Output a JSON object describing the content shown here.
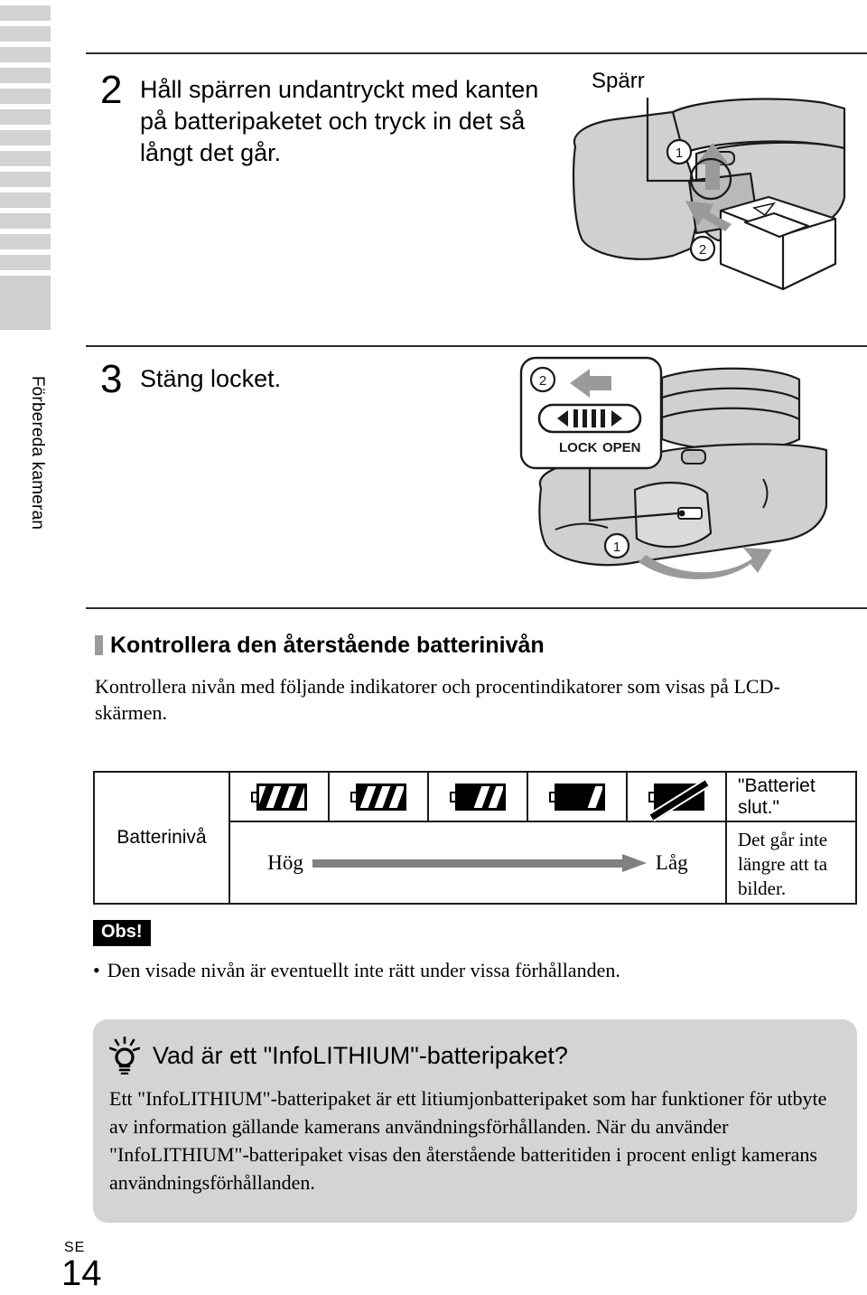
{
  "chapter_tab": {
    "label": "Förbereda kameran"
  },
  "steps": [
    {
      "number": "2",
      "text": "Håll spärren undantryckt med kanten på batteripaketet och tryck in det så långt det går.",
      "callout_label": "Spärr",
      "markers": [
        "1",
        "2"
      ]
    },
    {
      "number": "3",
      "text": "Stäng locket.",
      "switch_left_label": "LOCK",
      "switch_right_label": "OPEN",
      "markers": [
        "2",
        "1"
      ]
    }
  ],
  "section": {
    "heading": "Kontrollera den återstående batterinivån",
    "intro": "Kontrollera nivån med följande indikatorer och procentindikatorer som visas på LCD-skärmen."
  },
  "battery_table": {
    "row_label": "Batterinivå",
    "icons": [
      {
        "name": "battery-full-icon",
        "level": "full"
      },
      {
        "name": "battery-three-quarter-icon",
        "level": "three-quarter"
      },
      {
        "name": "battery-half-icon",
        "level": "half"
      },
      {
        "name": "battery-low-icon",
        "level": "low"
      },
      {
        "name": "battery-empty-crossed-icon",
        "level": "empty"
      }
    ],
    "depleted_status": "\"Batteriet slut.\"",
    "gauge_high": "Hög",
    "gauge_low": "Låg",
    "depleted_text": "Det går inte längre att ta bilder."
  },
  "note": {
    "badge": "Obs!",
    "bullet": "•",
    "items": [
      "Den visade nivån är eventuellt inte rätt under vissa förhållanden."
    ]
  },
  "tip": {
    "title": "Vad är ett \"InfoLITHIUM\"-batteripaket?",
    "body": "Ett \"InfoLITHIUM\"-batteripaket är ett litiumjonbatteripaket som har funktioner för utbyte av information gällande kamerans användningsförhållanden. När du använder \"InfoLITHIUM\"-batteripaket visas den återstående batteritiden i procent enligt kamerans användningsförhållanden."
  },
  "footer": {
    "locale": "SE",
    "page_number": "14"
  },
  "colors": {
    "tab_gray": "#d2d2d2",
    "tip_bg": "#d4d4d4",
    "gauge_arrow": "#808080",
    "rule": "#2b2b2b",
    "diagram_fill": "#d0d0d0"
  }
}
